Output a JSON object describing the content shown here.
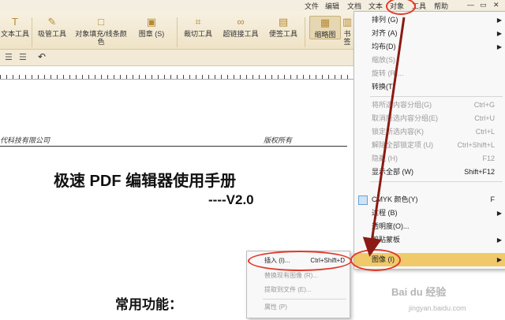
{
  "menubar": [
    "文件",
    "编辑",
    "文档",
    "文本",
    "对象",
    "工具",
    "帮助"
  ],
  "window_icons": [
    "—",
    "▭",
    "✕"
  ],
  "toolbar": {
    "buttons": [
      "文本工具",
      "吸管工具",
      "对象填充/线条颜色",
      "图章 (S)",
      "裁切工具",
      "超链接工具",
      "便签工具",
      "缩略图",
      "书签"
    ]
  },
  "doc": {
    "header_left": "代科技有限公司",
    "header_right": "版权所有",
    "title": "极速 PDF 编辑器使用手册",
    "version": "----V2.0",
    "section": "常用功能："
  },
  "object_menu": [
    {
      "label": "排列 (G)",
      "shortcut": "",
      "arrow": true,
      "disabled": false
    },
    {
      "label": "对齐 (A)",
      "shortcut": "",
      "arrow": true,
      "disabled": false
    },
    {
      "label": "均布(D)",
      "shortcut": "",
      "arrow": true,
      "disabled": false
    },
    {
      "label": "缩放(S)",
      "shortcut": "",
      "arrow": false,
      "disabled": true
    },
    {
      "label": "旋转 (R)...",
      "shortcut": "",
      "arrow": false,
      "disabled": true
    },
    {
      "label": "转换(T)",
      "shortcut": "",
      "arrow": false,
      "disabled": false
    },
    {
      "label": "将所选内容分组(G)",
      "shortcut": "Ctrl+G",
      "arrow": false,
      "disabled": true
    },
    {
      "label": "取消所选内容分组(E)",
      "shortcut": "Ctrl+U",
      "arrow": false,
      "disabled": true
    },
    {
      "label": "锁定所选内容(K)",
      "shortcut": "Ctrl+L",
      "arrow": false,
      "disabled": true
    },
    {
      "label": "解除全部锁定项 (U)",
      "shortcut": "Ctrl+Shift+L",
      "arrow": false,
      "disabled": true
    },
    {
      "label": "隐藏 (H)",
      "shortcut": "F12",
      "arrow": false,
      "disabled": true
    },
    {
      "label": "显示全部 (W)",
      "shortcut": "Shift+F12",
      "arrow": false,
      "disabled": false
    },
    {
      "label": "CMYK 颜色(Y)",
      "shortcut": "F",
      "arrow": false,
      "disabled": false
    },
    {
      "label": "过程 (B)",
      "shortcut": "",
      "arrow": true,
      "disabled": false
    },
    {
      "label": "透明度(O)...",
      "shortcut": "",
      "arrow": false,
      "disabled": false
    },
    {
      "label": "剪贴蒙板",
      "shortcut": "",
      "arrow": true,
      "disabled": false
    },
    {
      "label": "图像 (I)",
      "shortcut": "",
      "arrow": true,
      "disabled": false
    }
  ],
  "image_submenu": [
    {
      "label": "插入 (I)...",
      "shortcut": "Ctrl+Shift+D",
      "disabled": false
    },
    {
      "label": "替换现有图像 (R)...",
      "shortcut": "",
      "disabled": true
    },
    {
      "label": "提取到文件 (E)...",
      "shortcut": "",
      "disabled": true
    },
    {
      "label": "属性 (P)",
      "shortcut": "",
      "disabled": true
    }
  ],
  "watermark": {
    "brand": "Bai du 经验",
    "url": "jingyan.baidu.com"
  },
  "colors": {
    "highlight": "#f0c96a",
    "annotation": "#e03a2a",
    "toolbar": "#efe3c6"
  }
}
